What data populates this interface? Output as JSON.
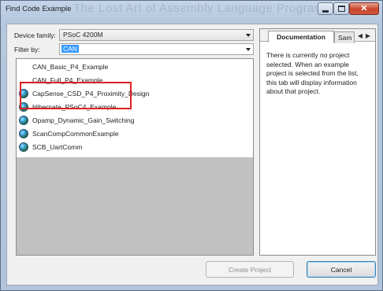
{
  "window": {
    "title": "Find Code Example",
    "background_title": "The Lost Art of Assembly Language Programming"
  },
  "form": {
    "device_family_label": "Device family:",
    "device_family_value": "PSoC 4200M",
    "filter_label": "Filter by:",
    "filter_value": "CAN"
  },
  "examples": [
    {
      "label": "CAN_Basic_P4_Example",
      "icon": "none"
    },
    {
      "label": "CAN_Full_P4_Example",
      "icon": "none"
    },
    {
      "label": "CapSense_CSD_P4_Proximity_Design",
      "icon": "globe-icon"
    },
    {
      "label": "Hibernate_PSoC4_Example",
      "icon": "globe-icon"
    },
    {
      "label": "Opamp_Dynamic_Gain_Switching",
      "icon": "globe-icon"
    },
    {
      "label": "ScanCompCommonExample",
      "icon": "globe-icon"
    },
    {
      "label": "SCB_UartComm",
      "icon": "globe-icon"
    }
  ],
  "tabs": {
    "documentation": "Documentation",
    "sample": "Sam"
  },
  "documentation_text": "There is currently no project selected. When an example project is selected from the list, this tab will display information about that project.",
  "buttons": {
    "create_project": "Create Project",
    "cancel": "Cancel"
  },
  "colors": {
    "highlight": "#e02020",
    "selection": "#3399ff",
    "close_button": "#c8452b"
  }
}
